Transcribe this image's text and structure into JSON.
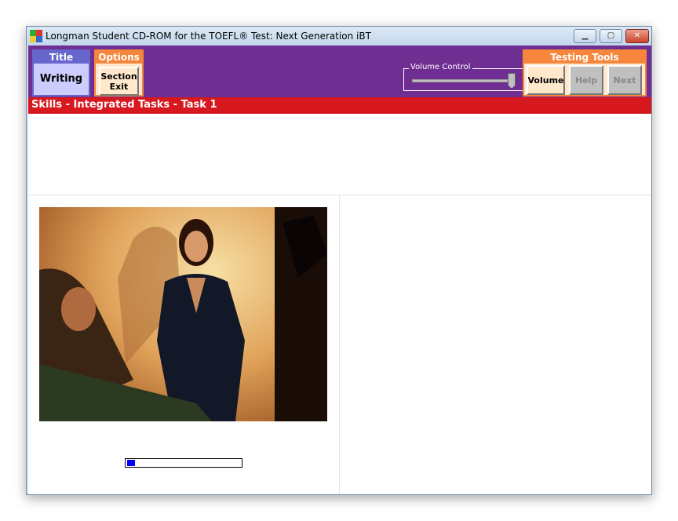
{
  "window": {
    "title": "Longman Student CD-ROM for the TOEFL® Test: Next Generation iBT",
    "minimize": "▁",
    "maximize": "▢",
    "close": "✕"
  },
  "toolbar": {
    "title_group": {
      "header": "Title",
      "value": "Writing"
    },
    "options_group": {
      "header": "Options",
      "section_exit": "Section\nExit"
    },
    "volume_control": {
      "label": "Volume Control",
      "level_percent": 100
    },
    "testing_tools": {
      "header": "Testing Tools",
      "volume": "Volume",
      "help": "Help",
      "next": "Next"
    }
  },
  "breadcrumb": "Skills - Integrated Tasks - Task 1",
  "audio_progress_percent": 7,
  "colors": {
    "purple": "#6f2e91",
    "red": "#d7181f",
    "orange": "#f5863c",
    "progress": "#0000ff"
  }
}
